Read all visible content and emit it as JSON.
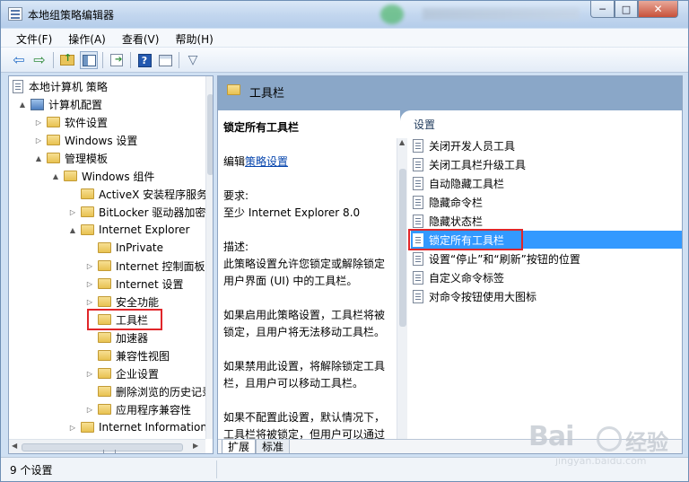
{
  "window": {
    "title": "本地组策略编辑器",
    "controls": {
      "minimize": "─",
      "maximize": "□",
      "close": "✕"
    }
  },
  "menu": [
    "文件(F)",
    "操作(A)",
    "查看(V)",
    "帮助(H)"
  ],
  "toolbar": {
    "icons": [
      "back-icon",
      "forward-icon",
      "up-folder-icon",
      "show-hide-tree-icon",
      "export-list-icon",
      "help-icon",
      "properties-icon",
      "filter-icon"
    ]
  },
  "tree": {
    "items": [
      {
        "label": "本地计算机 策略",
        "icon": "policy-doc-icon",
        "toggle": ""
      },
      {
        "label": "计算机配置",
        "icon": "computer-icon",
        "toggle": "▲"
      },
      {
        "label": "软件设置",
        "icon": "folder-icon",
        "toggle": "▷"
      },
      {
        "label": "Windows 设置",
        "icon": "folder-icon",
        "toggle": "▷"
      },
      {
        "label": "管理模板",
        "icon": "folder-icon",
        "toggle": "▲"
      },
      {
        "label": "Windows 组件",
        "icon": "folder-icon",
        "toggle": "▲"
      },
      {
        "label": "ActiveX 安装程序服务",
        "icon": "folder-icon",
        "toggle": ""
      },
      {
        "label": "BitLocker 驱动器加密",
        "icon": "folder-icon",
        "toggle": "▷"
      },
      {
        "label": "Internet Explorer",
        "icon": "folder-icon",
        "toggle": "▲"
      },
      {
        "label": "InPrivate",
        "icon": "folder-icon",
        "toggle": ""
      },
      {
        "label": "Internet 控制面板",
        "icon": "folder-icon",
        "toggle": "▷"
      },
      {
        "label": "Internet 设置",
        "icon": "folder-icon",
        "toggle": "▷"
      },
      {
        "label": "安全功能",
        "icon": "folder-icon",
        "toggle": "▷"
      },
      {
        "label": "工具栏",
        "icon": "folder-icon",
        "toggle": ""
      },
      {
        "label": "加速器",
        "icon": "folder-icon",
        "toggle": ""
      },
      {
        "label": "兼容性视图",
        "icon": "folder-icon",
        "toggle": ""
      },
      {
        "label": "企业设置",
        "icon": "folder-icon",
        "toggle": "▷"
      },
      {
        "label": "删除浏览的历史记录",
        "icon": "folder-icon",
        "toggle": ""
      },
      {
        "label": "应用程序兼容性",
        "icon": "folder-icon",
        "toggle": "▷"
      },
      {
        "label": "Internet Information Services",
        "icon": "folder-icon",
        "toggle": "▷"
      }
    ]
  },
  "right": {
    "header_title": "工具栏",
    "description": {
      "policy_name": "锁定所有工具栏",
      "edit_prefix": "编辑",
      "edit_link": "策略设置",
      "requirements_label": "要求:",
      "requirements_value": "至少 Internet Explorer 8.0",
      "description_label": "描述:",
      "p1": "此策略设置允许您锁定或解除锁定用户界面 (UI) 中的工具栏。",
      "p2": "如果启用此策略设置，工具栏将被锁定，且用户将无法移动工具栏。",
      "p3": "如果禁用此设置，将解除锁定工具栏，且用户可以移动工具栏。",
      "p4": "如果不配置此设置，默认情况下，工具栏将被锁定，但用户可以通过"
    },
    "list_header": "设置",
    "settings": [
      "关闭开发人员工具",
      "关闭工具栏升级工具",
      "自动隐藏工具栏",
      "隐藏命令栏",
      "隐藏状态栏",
      "锁定所有工具栏",
      "设置“停止”和“刷新”按钮的位置",
      "自定义命令标签",
      "对命令按钮使用大图标"
    ],
    "selected_setting": "锁定所有工具栏",
    "tabs": [
      "扩展",
      "标准"
    ]
  },
  "status": {
    "text": "9 个设置"
  },
  "watermark": {
    "brand": "Bai",
    "brand2": "经验",
    "url": "jingyan.baidu.com"
  },
  "colors": {
    "selection": "#3399ff",
    "highlight_box": "#e0262a",
    "header_band": "#8aa7c8"
  }
}
